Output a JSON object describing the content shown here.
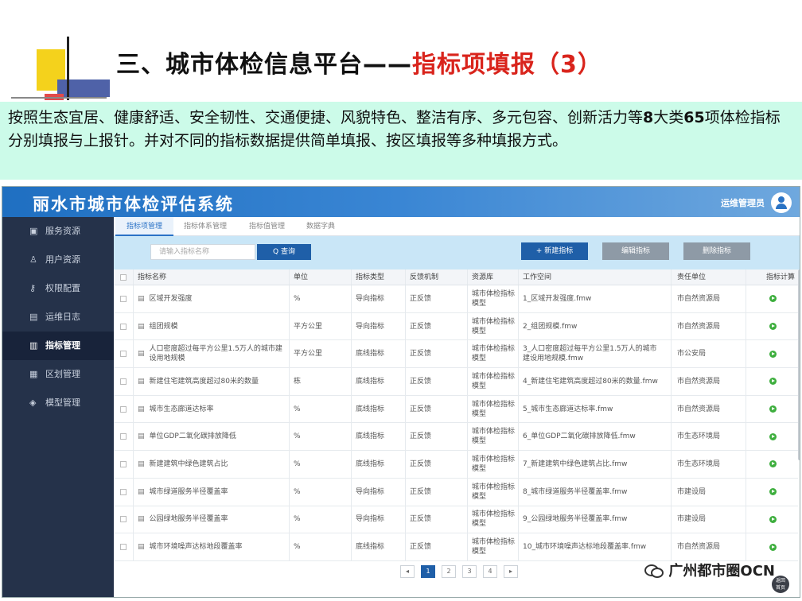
{
  "slide": {
    "title_main": "三、城市体检信息平台——",
    "title_highlight": "指标项填报（3）",
    "desc_part1": "按照生态宜居、健康舒适、安全韧性、交通便捷、风貌特色、整洁有序、多元包容、创新活力等",
    "desc_num1": "8",
    "desc_part2": "大类",
    "desc_num2": "65",
    "desc_part3": "项体检指标分别填报与上报针。并对不同的指标数据提供简单填报、按区填报等多种填报方式。"
  },
  "app": {
    "title": "丽水市城市体检评估系统",
    "user": "运维管理员"
  },
  "sidebar": {
    "items": [
      {
        "label": "服务资源",
        "icon": "server-icon",
        "glyph": "▣"
      },
      {
        "label": "用户资源",
        "icon": "user-icon",
        "glyph": "♙"
      },
      {
        "label": "权限配置",
        "icon": "key-icon",
        "glyph": "⚷"
      },
      {
        "label": "运维日志",
        "icon": "log-icon",
        "glyph": "▤"
      },
      {
        "label": "指标管理",
        "icon": "chart-icon",
        "glyph": "▥"
      },
      {
        "label": "区划管理",
        "icon": "map-icon",
        "glyph": "▦"
      },
      {
        "label": "模型管理",
        "icon": "cube-icon",
        "glyph": "◈"
      }
    ],
    "active_index": 4
  },
  "tabs": [
    "指标项管理",
    "指标体系管理",
    "指标值管理",
    "数据字典"
  ],
  "toolbar": {
    "search_placeholder": "请输入指标名称",
    "query_label": "Q 查询",
    "new_label": "+ 新建指标",
    "edit_label": "编辑指标",
    "delete_label": "删除指标"
  },
  "table": {
    "headers": [
      "指标名称",
      "单位",
      "指标类型",
      "反馈机制",
      "资源库",
      "工作空间",
      "责任单位",
      "指标计算"
    ],
    "rows": [
      {
        "name": "区域开发强度",
        "unit": "%",
        "type": "导向指标",
        "feedback": "正反馈",
        "repo": "城市体检指标模型",
        "workspace": "1_区域开发强度.fmw",
        "dept": "市自然资源局"
      },
      {
        "name": "组团规模",
        "unit": "平方公里",
        "type": "导向指标",
        "feedback": "正反馈",
        "repo": "城市体检指标模型",
        "workspace": "2_组团规模.fmw",
        "dept": "市自然资源局"
      },
      {
        "name": "人口密度超过每平方公里1.5万人的城市建设用地规模",
        "unit": "平方公里",
        "type": "底线指标",
        "feedback": "正反馈",
        "repo": "城市体检指标模型",
        "workspace": "3_人口密度超过每平方公里1.5万人的城市建设用地规模.fmw",
        "dept": "市公安局"
      },
      {
        "name": "新建住宅建筑高度超过80米的数量",
        "unit": "栋",
        "type": "底线指标",
        "feedback": "正反馈",
        "repo": "城市体检指标模型",
        "workspace": "4_新建住宅建筑高度超过80米的数量.fmw",
        "dept": "市自然资源局"
      },
      {
        "name": "城市生态廊道达标率",
        "unit": "%",
        "type": "底线指标",
        "feedback": "正反馈",
        "repo": "城市体检指标模型",
        "workspace": "5_城市生态廊道达标率.fmw",
        "dept": "市自然资源局"
      },
      {
        "name": "单位GDP二氧化碳排放降低",
        "unit": "%",
        "type": "底线指标",
        "feedback": "正反馈",
        "repo": "城市体检指标模型",
        "workspace": "6_单位GDP二氧化碳排放降低.fmw",
        "dept": "市生态环境局"
      },
      {
        "name": "新建建筑中绿色建筑占比",
        "unit": "%",
        "type": "底线指标",
        "feedback": "正反馈",
        "repo": "城市体检指标模型",
        "workspace": "7_新建建筑中绿色建筑占比.fmw",
        "dept": "市生态环境局"
      },
      {
        "name": "城市绿道服务半径覆盖率",
        "unit": "%",
        "type": "导向指标",
        "feedback": "正反馈",
        "repo": "城市体检指标模型",
        "workspace": "8_城市绿道服务半径覆盖率.fmw",
        "dept": "市建设局"
      },
      {
        "name": "公园绿地服务半径覆盖率",
        "unit": "%",
        "type": "导向指标",
        "feedback": "正反馈",
        "repo": "城市体检指标模型",
        "workspace": "9_公园绿地服务半径覆盖率.fmw",
        "dept": "市建设局"
      },
      {
        "name": "城市环境噪声达标地段覆盖率",
        "unit": "%",
        "type": "底线指标",
        "feedback": "正反馈",
        "repo": "城市体检指标模型",
        "workspace": "10_城市环境噪声达标地段覆盖率.fmw",
        "dept": "市自然资源局"
      }
    ]
  },
  "pager": {
    "prev": "◂",
    "pages": [
      "1",
      "2",
      "3",
      "4"
    ],
    "next": "▸",
    "current": 1
  },
  "home_button": {
    "line1": "返回",
    "line2": "首页"
  },
  "brand": "广州都市圈OCN"
}
